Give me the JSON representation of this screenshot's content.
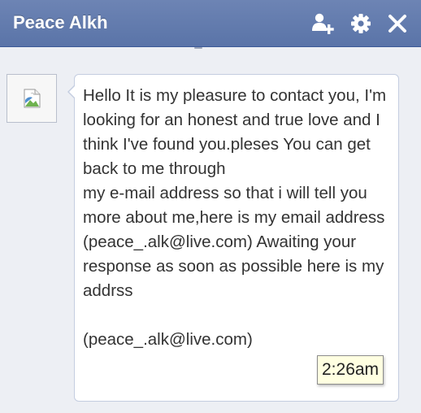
{
  "header": {
    "title": "Peace Alkh",
    "icons": [
      "add-friend-icon",
      "gear-icon",
      "close-icon"
    ]
  },
  "message": {
    "text": "Hello It is my pleasure to contact you, I'm looking for an honest and true love and I think I've found you.pleses You can get back to me through\n my e-mail address so that i will tell you more about me,here is my email address\n(peace_.alk@live.com) Awaiting your response as soon as possible here is my addrss\n\n(peace_.alk@live.com)"
  },
  "tooltip": {
    "time": "2:26am"
  },
  "colors": {
    "titlebar": "#6d84b4",
    "background": "#edeff4",
    "bubble_border": "#c4cde0",
    "tooltip_bg": "#ffffe1"
  }
}
